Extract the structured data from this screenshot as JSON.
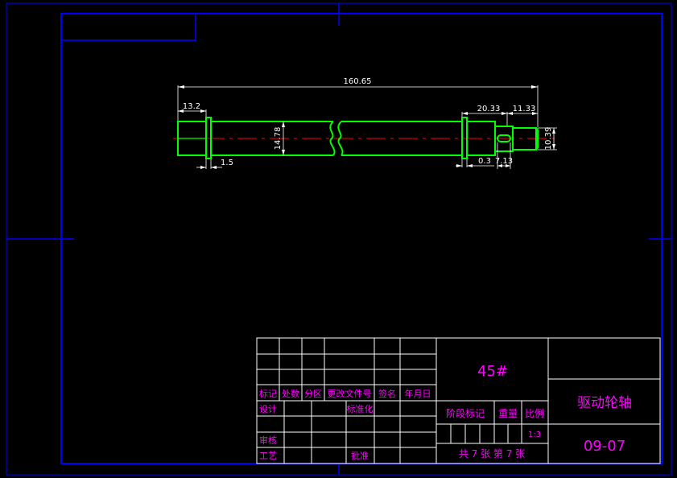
{
  "drawing": {
    "dimensions": {
      "overall_length": "160.65",
      "left_shoulder": "13.2",
      "right_section": "20.33",
      "right_end": "11.33",
      "main_diameter": "14.78",
      "end_diameter": "10.39",
      "groove_width": "1.5",
      "step_small": "0.3",
      "keyway_length": "7.13"
    }
  },
  "title_block": {
    "headers": {
      "mark": "标记",
      "count": "处数",
      "zone": "分区",
      "change_doc": "更改文件号",
      "signature": "签名",
      "date": "年月日"
    },
    "roles": {
      "design": "设计",
      "standardization": "标准化",
      "review": "审核",
      "process": "工艺",
      "approval": "批准"
    },
    "material": "45#",
    "part_name": "驱动轮轴",
    "stage_mark": "阶段标记",
    "weight": "重量",
    "scale_label": "比例",
    "scale_value": "1:3",
    "sheets": "共 7 张  第 7 张",
    "drawing_number": "09-07"
  },
  "colors": {
    "frame": "#0000ff",
    "part_outline": "#00ff00",
    "center_line": "#ff0000",
    "dimension": "#ffffff",
    "title_text": "#ff00ff"
  }
}
